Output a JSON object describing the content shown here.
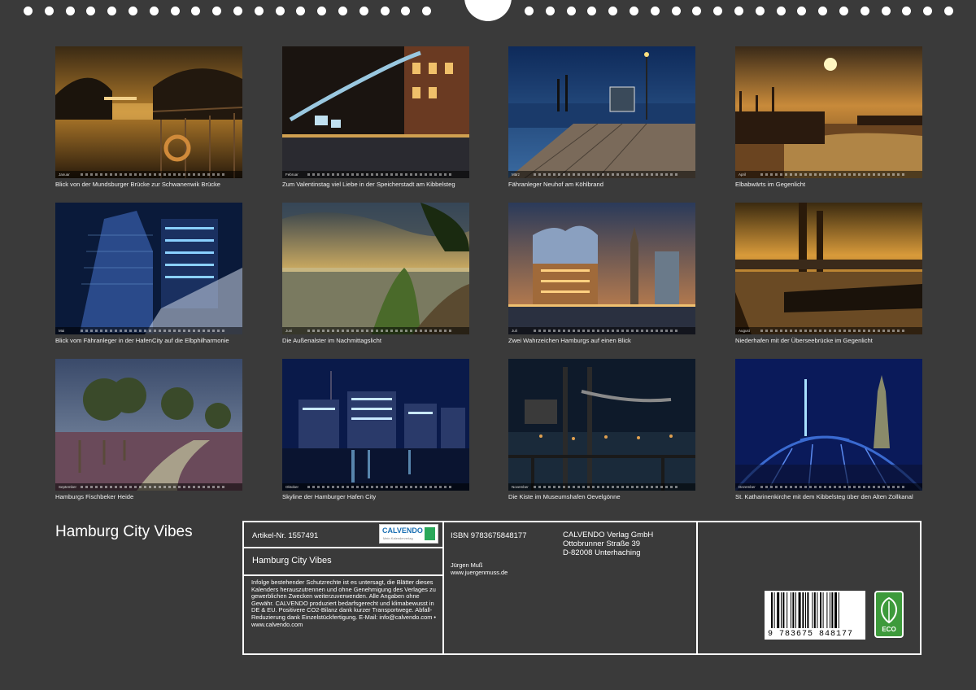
{
  "title": "Hamburg City Vibes",
  "months": [
    "Januar",
    "Februar",
    "März",
    "April",
    "Mai",
    "Juni",
    "Juli",
    "August",
    "September",
    "Oktober",
    "November",
    "Dezember"
  ],
  "photos": [
    {
      "caption": "Blick von der Mundsburger Brücke zur Schwanenwik Brücke",
      "theme": "canal-night"
    },
    {
      "caption": "Zum Valentinstag viel Liebe in der Speicherstadt am Kibbelsteg",
      "theme": "locks-bridge"
    },
    {
      "caption": "Fähranleger Neuhof am Köhlbrand",
      "theme": "pier-blue"
    },
    {
      "caption": "Elbabwärts im Gegenlicht",
      "theme": "harbor-sunset"
    },
    {
      "caption": "Blick vom Fähranleger in der HafenCity auf die Elbphilharmonie",
      "theme": "glass-building"
    },
    {
      "caption": "Die Außenalster im Nachmittagslicht",
      "theme": "lake-sky"
    },
    {
      "caption": "Zwei Wahrzeichen Hamburgs auf einen Blick",
      "theme": "elbphilharmonie"
    },
    {
      "caption": "Niederhafen mit der Überseebrücke im Gegenlicht",
      "theme": "harbor-gold"
    },
    {
      "caption": "Hamburgs Fischbeker Heide",
      "theme": "heath"
    },
    {
      "caption": "Skyline der Hamburger Hafen City",
      "theme": "skyline-night"
    },
    {
      "caption": "Die Kiste im Museumshafen Oevelgönne",
      "theme": "crane-night"
    },
    {
      "caption": "St. Katharinenkirche mit dem Kibbelsteg über den Alten Zollkanal",
      "theme": "blue-bridge"
    }
  ],
  "info": {
    "article": "Artikel-Nr. 1557491",
    "isbn": "ISBN 9783675848177",
    "publisher_name": "CALVENDO Verlag GmbH",
    "publisher_street": "Ottobrunner Straße 39",
    "publisher_city": "D-82008 Unterhaching",
    "calendar_title": "Hamburg City Vibes",
    "author": "Jürgen Muß",
    "author_url": "www.juergenmuss.de",
    "legal": "Infolge bestehender Schutzrechte ist es untersagt, die Blätter dieses Kalenders herauszutrennen und ohne Genehmigung des Verlages zu gewerblichen Zwecken weiterzuverwenden. Alle Angaben ohne Gewähr. CALVENDO produziert bedarfsgerecht und klimabewusst in DE & EU. Positivere CO2-Bilanz dank kurzer Transportwege. Abfall-Reduzierung dank Einzelstückfertigung. E-Mail: info@calvendo.com • www.calvendo.com",
    "logo_text": "CALVENDO",
    "logo_sub": "Mein Kalenderverlag",
    "barcode_number": "9 783675 848177",
    "eco_label": "ECO"
  }
}
